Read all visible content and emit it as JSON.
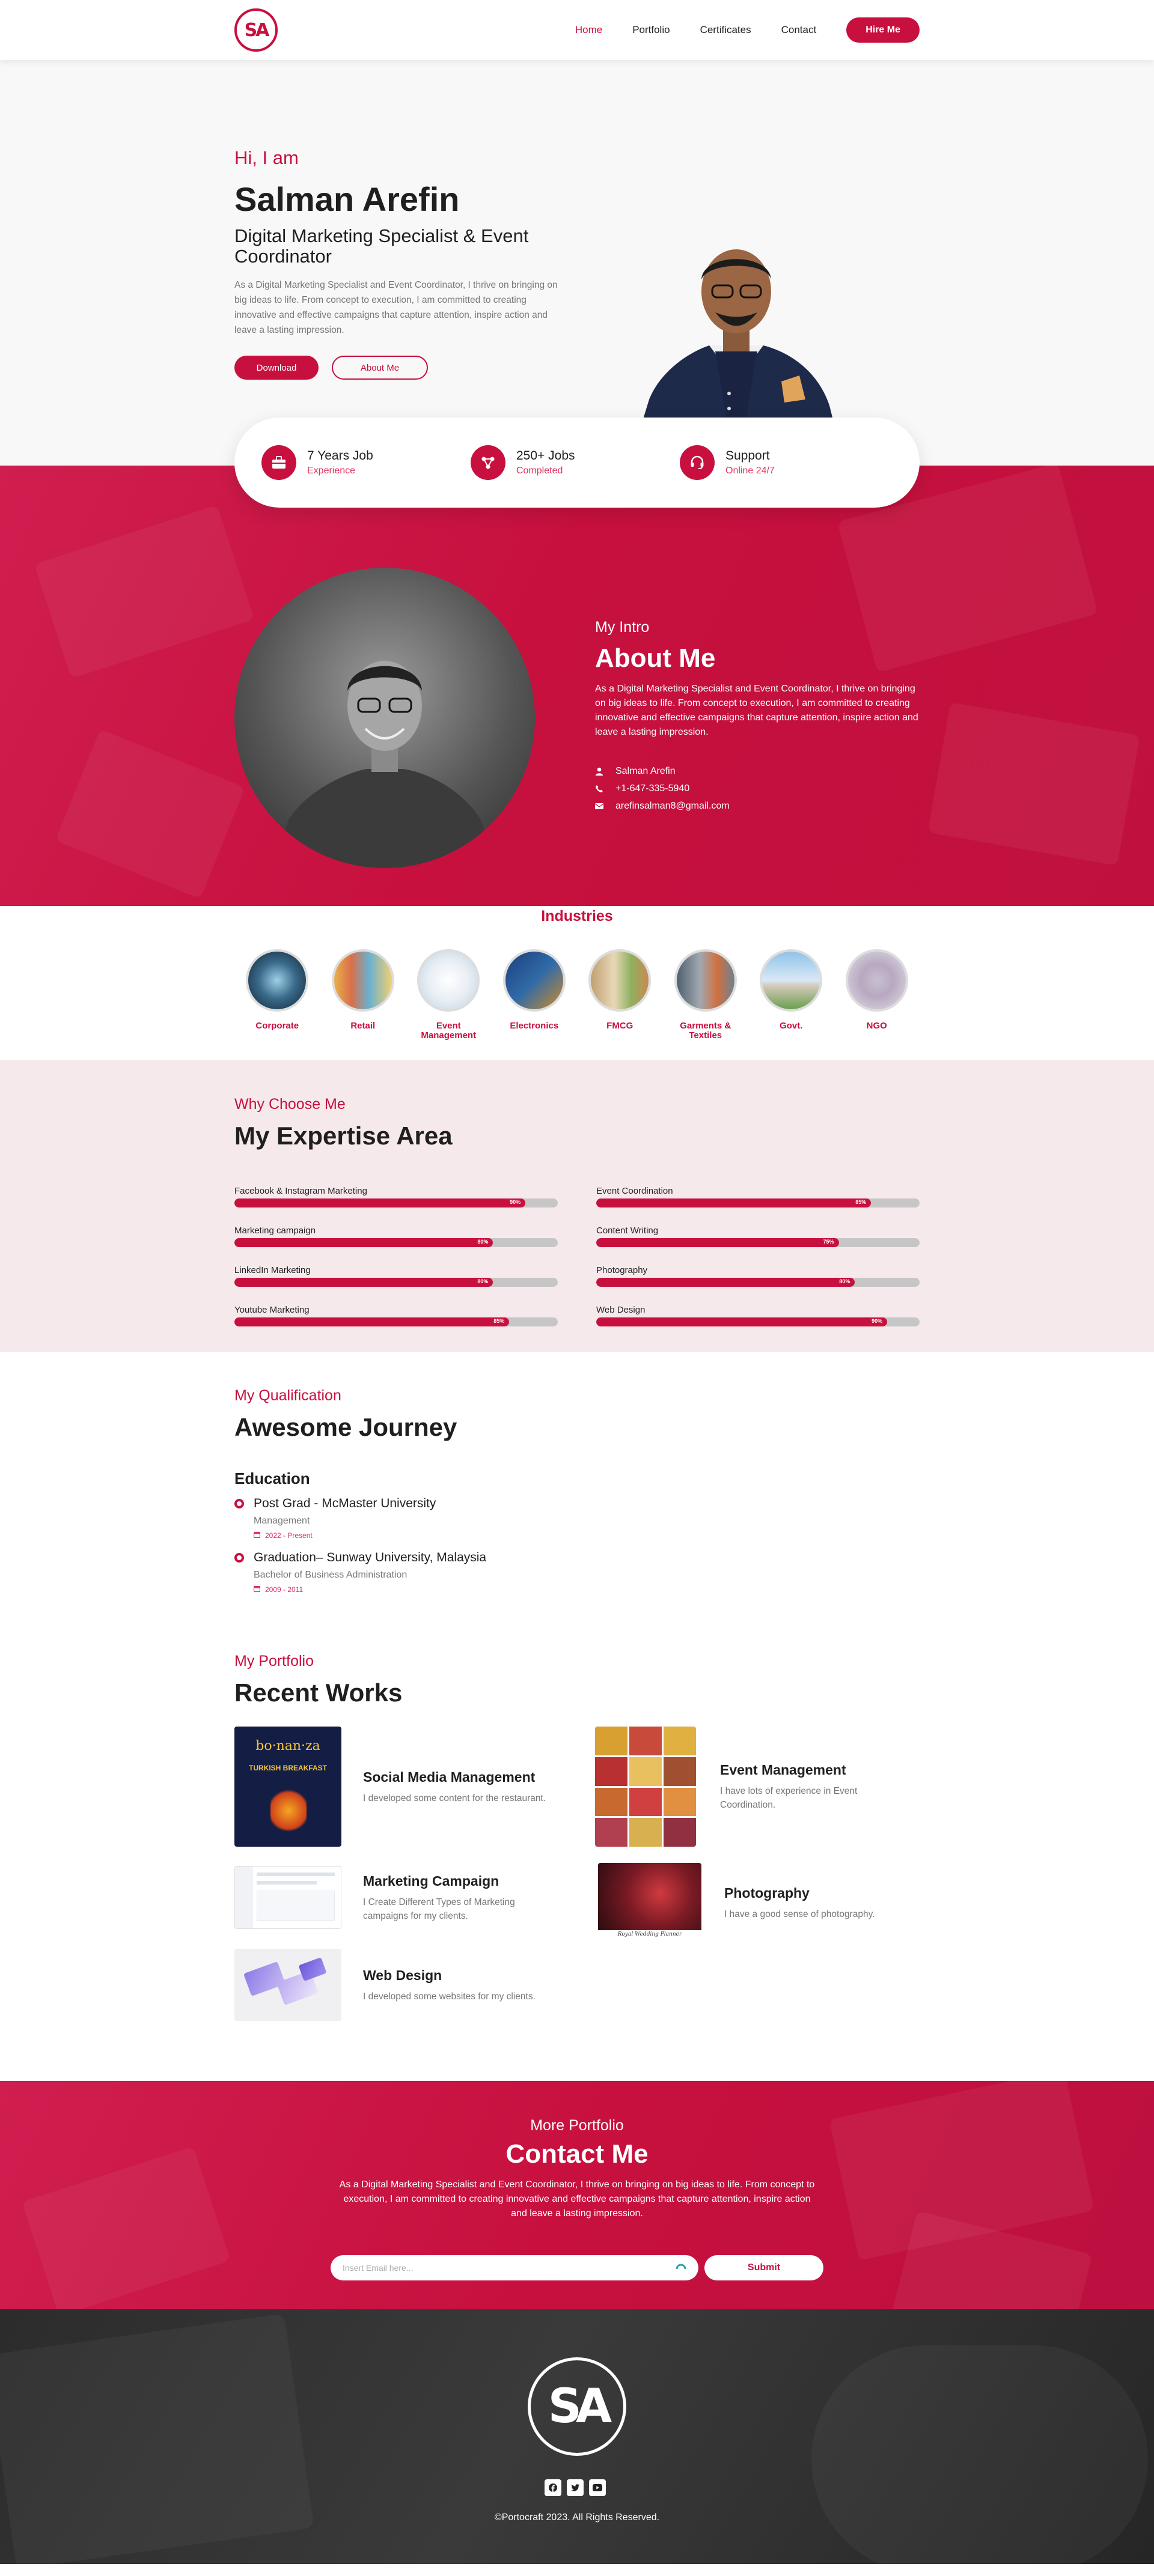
{
  "brand": {
    "logo_text": "SA",
    "accent": "#c8103e"
  },
  "nav": {
    "items": [
      "Home",
      "Portfolio",
      "Certificates",
      "Contact"
    ],
    "active": "Home",
    "hire_label": "Hire Me"
  },
  "hero": {
    "greeting": "Hi, I am",
    "name": "Salman Arefin",
    "role": "Digital Marketing Specialist & Event Coordinator",
    "description": "As a Digital Marketing Specialist and Event Coordinator, I thrive on bringing on big ideas to life. From concept to execution, I am committed to creating innovative and effective campaigns that capture attention, inspire action and leave a lasting impression.",
    "download_label": "Download",
    "about_label": "About Me"
  },
  "stats": [
    {
      "icon": "briefcase-icon",
      "title": "7 Years Job",
      "sub": "Experience"
    },
    {
      "icon": "network-icon",
      "title": "250+ Jobs",
      "sub": "Completed"
    },
    {
      "icon": "headset-icon",
      "title": "Support",
      "sub": "Online 24/7"
    }
  ],
  "about": {
    "kicker": "My Intro",
    "title": "About Me",
    "text": "As a Digital Marketing Specialist and Event Coordinator, I thrive on bringing on big ideas to life. From concept to execution, I am committed to creating innovative and effective campaigns that capture attention, inspire action and leave a lasting impression.",
    "name": "Salman Arefin",
    "phone": "+1-647-335-5940",
    "email": "arefinsalman8@gmail.com"
  },
  "industries": {
    "title": "Industries",
    "items": [
      "Corporate",
      "Retail",
      "Event Management",
      "Electronics",
      "FMCG",
      "Garments & Textiles",
      "Govt.",
      "NGO"
    ]
  },
  "expertise": {
    "kicker": "Why Choose Me",
    "title": "My Expertise Area",
    "skills": [
      {
        "name": "Facebook & Instagram Marketing",
        "pct": 90,
        "label": "90%"
      },
      {
        "name": "Event Coordination",
        "pct": 85,
        "label": "85%"
      },
      {
        "name": "Marketing campaign",
        "pct": 80,
        "label": "80%"
      },
      {
        "name": "Content Writing",
        "pct": 75,
        "label": "75%"
      },
      {
        "name": "LinkedIn Marketing",
        "pct": 80,
        "label": "80%"
      },
      {
        "name": "Photography",
        "pct": 80,
        "label": "80%"
      },
      {
        "name": "Youtube Marketing",
        "pct": 85,
        "label": "85%"
      },
      {
        "name": "Web Design",
        "pct": 90,
        "label": "90%"
      }
    ]
  },
  "journey": {
    "kicker": "My Qualification",
    "title": "Awesome Journey",
    "section": "Education",
    "items": [
      {
        "title": "Post Grad - McMaster University",
        "sub": "Management",
        "date": "2022 - Present"
      },
      {
        "title": "Graduation– Sunway University, Malaysia",
        "sub": "Bachelor of Business Administration",
        "date": "2009 - 2011"
      }
    ]
  },
  "portfolio": {
    "kicker": "My Portfolio",
    "title": "Recent Works",
    "works": [
      {
        "title": "Social Media Management",
        "desc": "I developed some content for the restaurant."
      },
      {
        "title": "Event Management",
        "desc": "I have lots of experience in Event Coordination."
      },
      {
        "title": "Marketing Campaign",
        "desc": "I Create Different Types of Marketing campaigns for my clients."
      },
      {
        "title": "Photography",
        "desc": "I have a good sense of photography."
      },
      {
        "title": "Web Design",
        "desc": "I developed some websites for my clients."
      }
    ],
    "restaurant_art": "bo·nan·za",
    "restaurant_sub": "TURKISH BREAKFAST",
    "photo_caption": "Royal Wedding Planner"
  },
  "contact": {
    "kicker": "More Portfolio",
    "title": "Contact Me",
    "text": "As a Digital Marketing Specialist and Event Coordinator, I thrive on bringing on big ideas to life. From concept to execution, I am committed to creating innovative and effective campaigns that capture attention, inspire action and leave a lasting impression.",
    "email_placeholder": "Insert Email here...",
    "submit_label": "Submit"
  },
  "footer": {
    "logo_text": "SA",
    "socials": [
      "facebook-icon",
      "twitter-icon",
      "youtube-icon"
    ],
    "copyright": "©Portocraft 2023. All Rights Reserved."
  }
}
